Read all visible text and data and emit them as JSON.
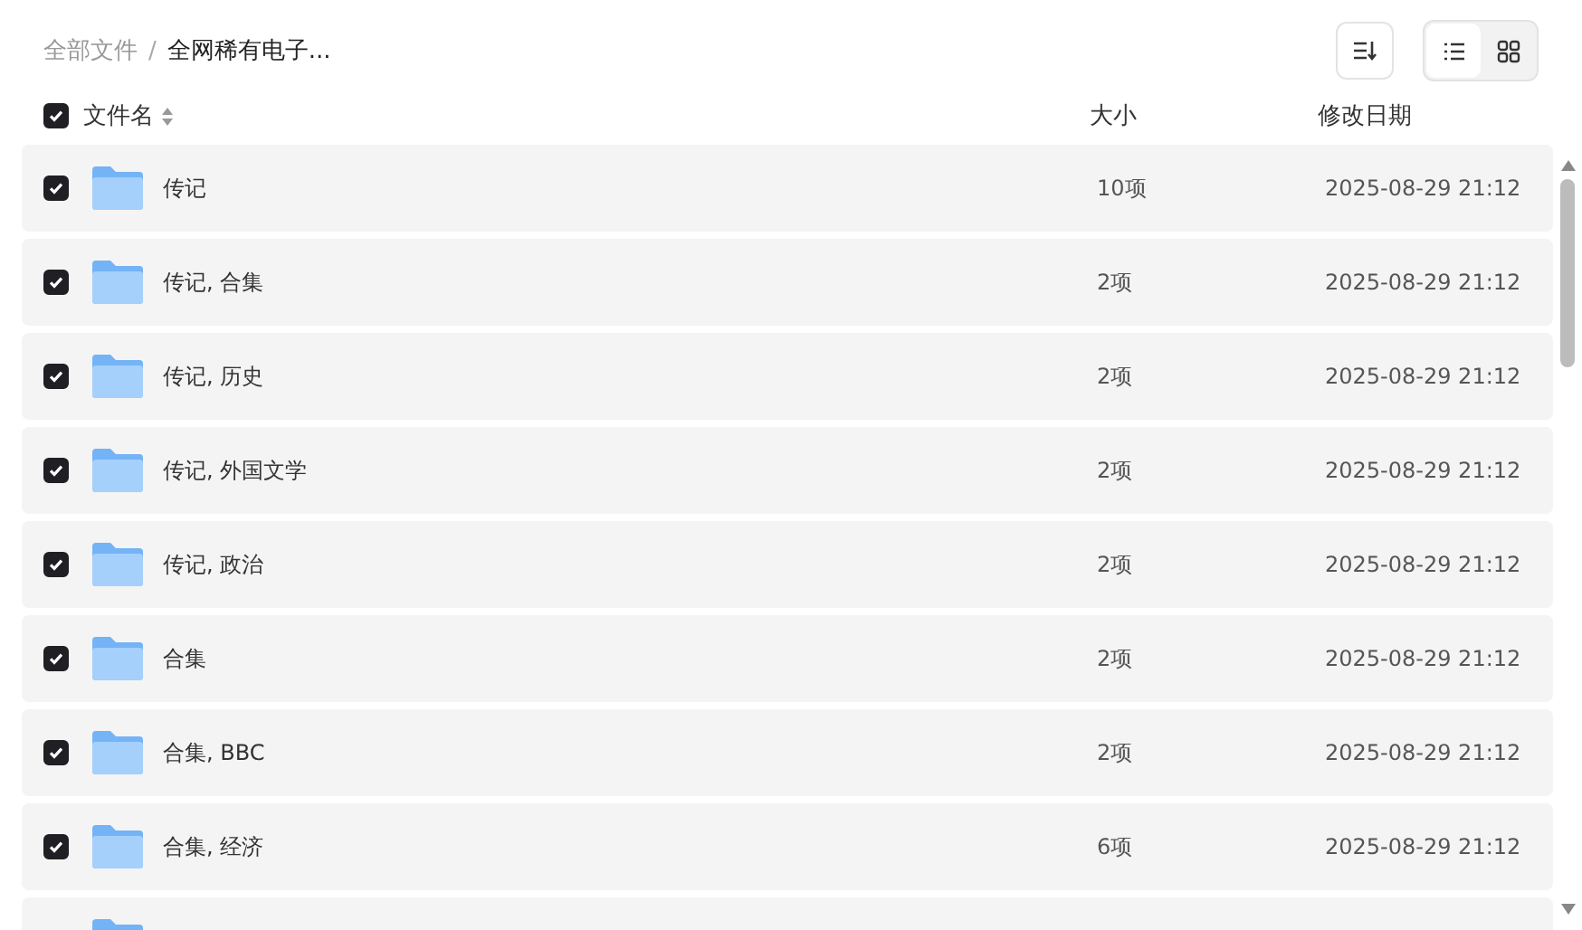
{
  "breadcrumb": [
    {
      "label": "全部文件",
      "current": false
    },
    {
      "label": "全网稀有电子...",
      "current": true
    }
  ],
  "breadcrumb_separator": "/",
  "view_toggle": [
    {
      "kind": "list",
      "selected": true
    },
    {
      "kind": "grid",
      "selected": false
    }
  ],
  "header": {
    "checked": true,
    "columns": [
      "文件名",
      "大小",
      "修改日期"
    ]
  },
  "rows": [
    {
      "name": "传记",
      "size": "10项",
      "date": "2025-08-29 21:12",
      "checked": true
    },
    {
      "name": "传记, 合集",
      "size": "2项",
      "date": "2025-08-29 21:12",
      "checked": true
    },
    {
      "name": "传记, 历史",
      "size": "2项",
      "date": "2025-08-29 21:12",
      "checked": true
    },
    {
      "name": "传记, 外国文学",
      "size": "2项",
      "date": "2025-08-29 21:12",
      "checked": true
    },
    {
      "name": "传记, 政治",
      "size": "2项",
      "date": "2025-08-29 21:12",
      "checked": true
    },
    {
      "name": "合集",
      "size": "2项",
      "date": "2025-08-29 21:12",
      "checked": true
    },
    {
      "name": "合集, BBC",
      "size": "2项",
      "date": "2025-08-29 21:12",
      "checked": true
    },
    {
      "name": "合集, 经济",
      "size": "6项",
      "date": "2025-08-29 21:12",
      "checked": true
    }
  ]
}
